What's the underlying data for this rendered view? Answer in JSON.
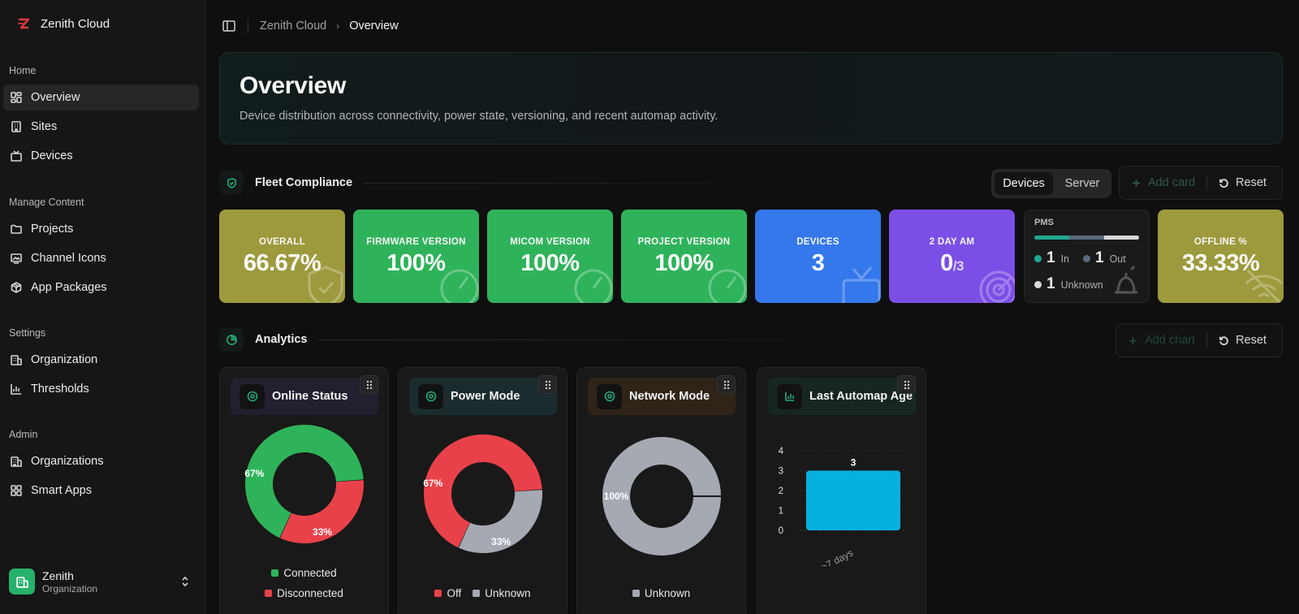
{
  "app": {
    "name": "Zenith Cloud"
  },
  "sidebar": {
    "sections": [
      {
        "label": "Home",
        "items": [
          {
            "label": "Overview",
            "icon": "dashboard-icon",
            "active": true
          },
          {
            "label": "Sites",
            "icon": "building-icon"
          },
          {
            "label": "Devices",
            "icon": "tv-icon"
          }
        ]
      },
      {
        "label": "Manage Content",
        "items": [
          {
            "label": "Projects",
            "icon": "folder-icon"
          },
          {
            "label": "Channel Icons",
            "icon": "image-icon"
          },
          {
            "label": "App Packages",
            "icon": "package-icon"
          }
        ]
      },
      {
        "label": "Settings",
        "items": [
          {
            "label": "Organization",
            "icon": "building-icon"
          },
          {
            "label": "Thresholds",
            "icon": "bar-chart-icon"
          }
        ]
      },
      {
        "label": "Admin",
        "items": [
          {
            "label": "Organizations",
            "icon": "buildings-icon"
          },
          {
            "label": "Smart Apps",
            "icon": "grid-icon"
          }
        ]
      }
    ],
    "org": {
      "name": "Zenith",
      "subtitle": "Organization"
    }
  },
  "breadcrumb": {
    "root": "Zenith Cloud",
    "current": "Overview"
  },
  "hero": {
    "title": "Overview",
    "description": "Device distribution across connectivity, power state, versioning, and recent automap activity."
  },
  "fleet": {
    "title": "Fleet Compliance",
    "toggle": {
      "options": [
        "Devices",
        "Server"
      ],
      "selected": "Devices"
    },
    "add_label": "Add card",
    "reset_label": "Reset",
    "cards": [
      {
        "label": "OVERALL",
        "value": "66.67%",
        "color": "#9c9a3c",
        "icon": "shield-check-icon"
      },
      {
        "label": "FIRMWARE VERSION",
        "value": "100%",
        "color": "#2fb35a",
        "icon": "gauge-icon"
      },
      {
        "label": "MICOM VERSION",
        "value": "100%",
        "color": "#2fb35a",
        "icon": "gauge-icon"
      },
      {
        "label": "PROJECT VERSION",
        "value": "100%",
        "color": "#2fb35a",
        "icon": "gauge-icon"
      },
      {
        "label": "DEVICES",
        "value": "3",
        "color": "#3478ec",
        "icon": "tv-icon"
      },
      {
        "label": "2 DAY AM",
        "value": "0",
        "value_sub": "/3",
        "color": "#7b4fe6",
        "icon": "radar-icon"
      }
    ],
    "pms": {
      "title": "PMS",
      "bar": [
        {
          "fraction": 0.333,
          "color": "#1fa88e"
        },
        {
          "fraction": 0.333,
          "color": "#5b6b80"
        },
        {
          "fraction": 0.334,
          "color": "#d9d9dc"
        }
      ],
      "rows": [
        {
          "value": "1",
          "label": "In",
          "color": "#1fa88e"
        },
        {
          "value": "1",
          "label": "Out",
          "color": "#5b6b80"
        },
        {
          "value": "1",
          "label": "Unknown",
          "color": "#d9d9dc"
        }
      ],
      "icon": "bell-icon"
    },
    "offline": {
      "label": "OFFLINE %",
      "value": "33.33%",
      "color": "#9c9a3c",
      "icon": "wifi-off-icon"
    }
  },
  "analytics": {
    "title": "Analytics",
    "add_label": "Add chart",
    "reset_label": "Reset",
    "charts": [
      {
        "title": "Online Status",
        "icon": "donut-icon",
        "head_color": "#231f2e",
        "chart_data": {
          "type": "pie",
          "values": [
            67,
            33
          ],
          "labels": [
            "67%",
            "33%"
          ],
          "categories": [
            "Connected",
            "Disconnected"
          ],
          "colors": [
            "#2fb35a",
            "#e9414a"
          ]
        }
      },
      {
        "title": "Power Mode",
        "icon": "donut-icon",
        "head_color": "#1b2c2f",
        "chart_data": {
          "type": "pie",
          "values": [
            67,
            33
          ],
          "labels": [
            "67%",
            "33%"
          ],
          "categories": [
            "Off",
            "Unknown"
          ],
          "colors": [
            "#e9414a",
            "#a4a9b2"
          ]
        }
      },
      {
        "title": "Network Mode",
        "icon": "donut-icon",
        "head_color": "#2f2417",
        "chart_data": {
          "type": "pie",
          "values": [
            100
          ],
          "labels": [
            "100%"
          ],
          "categories": [
            "Unknown"
          ],
          "colors": [
            "#a4a9b2"
          ]
        }
      },
      {
        "title": "Last Automap Age",
        "icon": "bar-chart-icon",
        "head_color": "#172621",
        "chart_data": {
          "type": "bar",
          "categories": [
            ">7 days"
          ],
          "values": [
            3
          ],
          "ylim": [
            0,
            4
          ],
          "yticks": [
            "0",
            "1",
            "2",
            "3",
            "4"
          ],
          "colors": [
            "#06b1e0"
          ]
        }
      }
    ]
  }
}
